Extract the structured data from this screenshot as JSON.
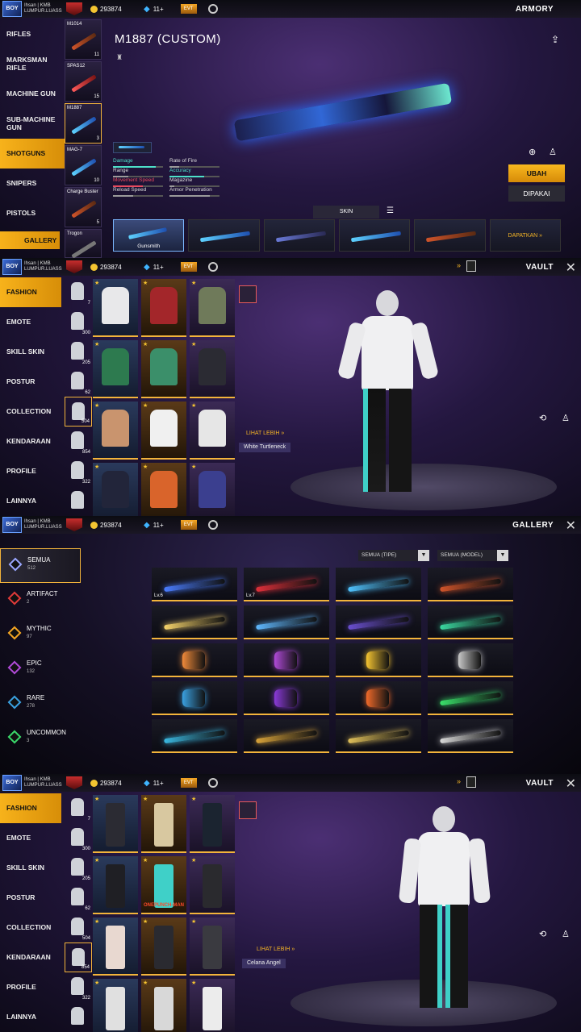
{
  "player": {
    "name": "Ihsan | KMB",
    "guild": "LUMPUR.LUASS",
    "gold": "293874",
    "diamonds": "11+",
    "avatar_text": "BOY",
    "event_badge": "EVT"
  },
  "armory": {
    "title": "ARMORY",
    "categories": [
      "RIFLES",
      "MARKSMAN RIFLE",
      "MACHINE GUN",
      "SUB-MACHINE GUN",
      "SHOTGUNS",
      "SNIPERS",
      "PISTOLS"
    ],
    "gallery_btn": "GALLERY",
    "weapons": [
      {
        "name": "M1014",
        "count": "11"
      },
      {
        "name": "SPAS12",
        "count": "15"
      },
      {
        "name": "M1887",
        "count": "3"
      },
      {
        "name": "MAG-7",
        "count": "10"
      },
      {
        "name": "Charge Buster",
        "count": "5"
      },
      {
        "name": "Trogon",
        "count": ""
      }
    ],
    "weapon_title": "M1887 (CUSTOM)",
    "stats": [
      {
        "name": "Damage",
        "val": 0.85,
        "color": "#4de0c9"
      },
      {
        "name": "Rate of Fire",
        "val": 0.2,
        "color": "#9a9a9a"
      },
      {
        "name": "Range",
        "val": 0.3,
        "color": "#9a9a9a"
      },
      {
        "name": "Accuracy",
        "val": 0.7,
        "color": "#4de0c9"
      },
      {
        "name": "Movement Speed",
        "val": 0.6,
        "color": "#e84a5f"
      },
      {
        "name": "Magazine",
        "val": 0.1,
        "color": "#9a9a9a"
      },
      {
        "name": "Reload Speed",
        "val": 0.4,
        "color": "#9a9a9a"
      },
      {
        "name": "Armor Penetration",
        "val": 0.8,
        "color": "#9a9a9a"
      }
    ],
    "ubah": "UBAH",
    "dipakai": "DIPAKAI",
    "skin_tab": "SKIN",
    "skins": [
      {
        "label": "Gunsmith"
      },
      {
        "label": ""
      },
      {
        "label": ""
      },
      {
        "label": ""
      },
      {
        "label": ""
      }
    ],
    "dapatkan": "DAPATKAN »"
  },
  "vault1": {
    "title": "VAULT",
    "categories": [
      "FASHION",
      "EMOTE",
      "SKILL SKIN",
      "POSTUR",
      "COLLECTION",
      "KENDARAAN",
      "PROFILE",
      "LAINNYA"
    ],
    "sub_counts": [
      "7",
      "300",
      "205",
      "62",
      "504",
      "854",
      "322",
      ""
    ],
    "lihat": "LIHAT LEBIH »",
    "item": "White Turtleneck",
    "cells": [
      {
        "c": "#e8e8ea"
      },
      {
        "c": "#a3262a"
      },
      {
        "c": "#6f7a5a"
      },
      {
        "c": "#2d7a4f"
      },
      {
        "c": "#3b8f6a"
      },
      {
        "c": "#2b2b33"
      },
      {
        "c": "#c9946e"
      },
      {
        "c": "#f0f0f0"
      },
      {
        "c": "#e6e6e6"
      },
      {
        "c": "#22253a"
      },
      {
        "c": "#d9642b"
      },
      {
        "c": "#3b3f8f"
      }
    ]
  },
  "gallery": {
    "title": "GALLERY",
    "filters": [
      {
        "label": "SEMUA",
        "count": "512",
        "color": "#9aa7ff"
      },
      {
        "label": "ARTIFACT",
        "count": "2",
        "color": "#e03a3a"
      },
      {
        "label": "MYTHIC",
        "count": "97",
        "color": "#f5a623"
      },
      {
        "label": "EPIC",
        "count": "132",
        "color": "#b04ad8"
      },
      {
        "label": "RARE",
        "count": "278",
        "color": "#3aa0e0"
      },
      {
        "label": "UNCOMMON",
        "count": "3",
        "color": "#3ad86a"
      }
    ],
    "dd1": "SEMUA (TIPE)",
    "dd2": "SEMUA (MODEL)",
    "items": [
      {
        "lv": "Lv.6",
        "c": "#4a7dff",
        "k": "ln"
      },
      {
        "lv": "Lv.7",
        "c": "#e0303a",
        "k": "ln"
      },
      {
        "lv": "",
        "c": "#4fc3ff",
        "k": "ln"
      },
      {
        "lv": "",
        "c": "#d0542a",
        "k": "ln"
      },
      {
        "lv": "",
        "c": "#f5d36b",
        "k": "ln"
      },
      {
        "lv": "",
        "c": "#5fb8ff",
        "k": "ln"
      },
      {
        "lv": "",
        "c": "#6a4fd0",
        "k": "ln"
      },
      {
        "lv": "",
        "c": "#3ad8a0",
        "k": "ln"
      },
      {
        "lv": "",
        "c": "#f08a3a",
        "k": "ob"
      },
      {
        "lv": "",
        "c": "#b04ad8",
        "k": "ob"
      },
      {
        "lv": "",
        "c": "#f5c431",
        "k": "ob"
      },
      {
        "lv": "",
        "c": "#c8c8c8",
        "k": "ob"
      },
      {
        "lv": "",
        "c": "#3aa0e0",
        "k": "ob"
      },
      {
        "lv": "",
        "c": "#8a3ad8",
        "k": "ob"
      },
      {
        "lv": "",
        "c": "#f06a2a",
        "k": "ob"
      },
      {
        "lv": "",
        "c": "#3ae06a",
        "k": "ln"
      },
      {
        "lv": "",
        "c": "#3ab8e0",
        "k": "ln"
      },
      {
        "lv": "",
        "c": "#d8a33a",
        "k": "ln"
      },
      {
        "lv": "",
        "c": "#e0c05a",
        "k": "ln"
      },
      {
        "lv": "",
        "c": "#d8d8d8",
        "k": "ln"
      }
    ]
  },
  "vault2": {
    "title": "VAULT",
    "categories": [
      "FASHION",
      "EMOTE",
      "SKILL SKIN",
      "POSTUR",
      "COLLECTION",
      "KENDARAAN",
      "PROFILE",
      "LAINNYA"
    ],
    "sub_counts": [
      "7",
      "300",
      "205",
      "62",
      "504",
      "854",
      "322",
      ""
    ],
    "lihat": "LIHAT LEBIH »",
    "item": "Celana Angel",
    "cell_label": "ONEPUNCH-MAN",
    "cells": [
      {
        "c": "#2b2b33"
      },
      {
        "c": "#d8c8a0"
      },
      {
        "c": "#1b2430"
      },
      {
        "c": "#1f1f24"
      },
      {
        "c": "#3fd0c8"
      },
      {
        "c": "#2a2a2e"
      },
      {
        "c": "#e8d8d0"
      },
      {
        "c": "#2a2a30"
      },
      {
        "c": "#3a3a40"
      },
      {
        "c": "#e0e0e0"
      },
      {
        "c": "#d8d8d8"
      },
      {
        "c": "#ececec"
      }
    ]
  }
}
